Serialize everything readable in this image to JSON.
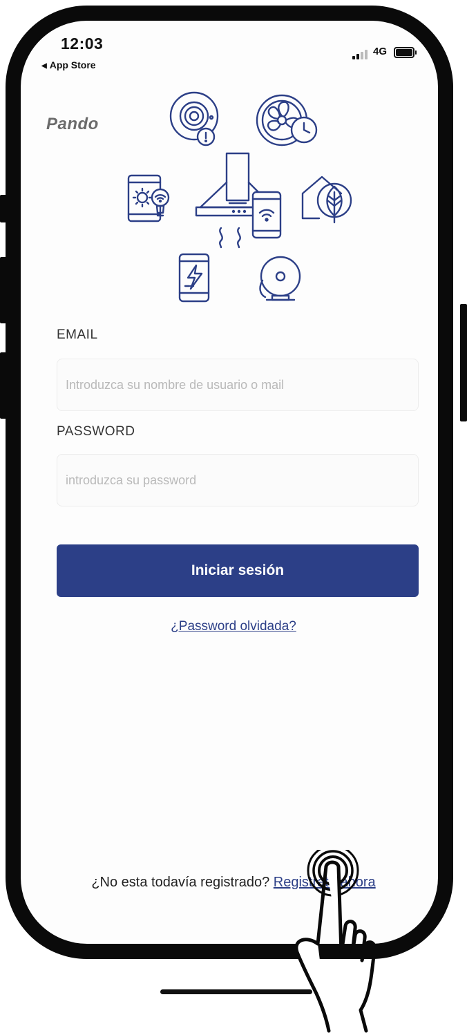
{
  "status_bar": {
    "time": "12:03",
    "back_app": "App Store",
    "network": "4G"
  },
  "brand": "Pando",
  "hero_illustration": {
    "icons": [
      "smoke-detector-icon",
      "fan-timer-icon",
      "tablet-bulb-icon",
      "kitchen-hood-icon",
      "phone-wifi-icon",
      "eco-home-icon",
      "phone-energy-icon",
      "alarm-bell-icon"
    ],
    "color": "#2c3f87"
  },
  "form": {
    "email_label": "EMAIL",
    "email_placeholder": "Introduzca su nombre de usuario o mail",
    "password_label": "PASSWORD",
    "password_placeholder": "introduzca su password",
    "login_button": "Iniciar sesión",
    "forgot_link": "¿Password olvidada?"
  },
  "footer": {
    "register_prompt": "¿No esta todavía registrado?",
    "register_link": "Registrate ahora"
  },
  "colors": {
    "accent": "#2c3f87",
    "placeholder": "#b9b9b9",
    "frame": "#0a0a0a"
  }
}
